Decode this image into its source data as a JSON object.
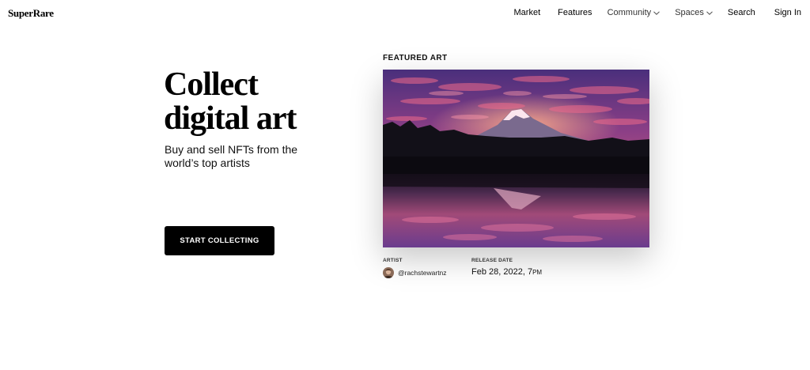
{
  "header": {
    "logo": "SuperRare",
    "nav": [
      {
        "label": "Market"
      },
      {
        "label": "Features"
      },
      {
        "label": "Community"
      },
      {
        "label": "Spaces"
      },
      {
        "label": "Search"
      },
      {
        "label": "Sign In"
      }
    ]
  },
  "hero": {
    "title_line1": "Collect",
    "title_line2": "digital art",
    "subtitle": "Buy and sell NFTs from the world’s top artists",
    "cta_label": "START COLLECTING"
  },
  "featured": {
    "section_label": "FEATURED ART",
    "artist_label": "ARTIST",
    "artist_handle": "@rachstewartnz",
    "release_label": "RELEASE DATE",
    "release_date": "Feb 28, 2022, 7",
    "release_suffix": "PM"
  },
  "icons": {
    "community_chevron": "chevron-down-icon",
    "spaces_chevron": "chevron-down-icon"
  },
  "colors": {
    "button_bg": "#000000",
    "button_text": "#ffffff",
    "sky_top": "#5a3a8a",
    "sky_mid": "#c8527a",
    "sky_glow": "#f08a6a"
  }
}
